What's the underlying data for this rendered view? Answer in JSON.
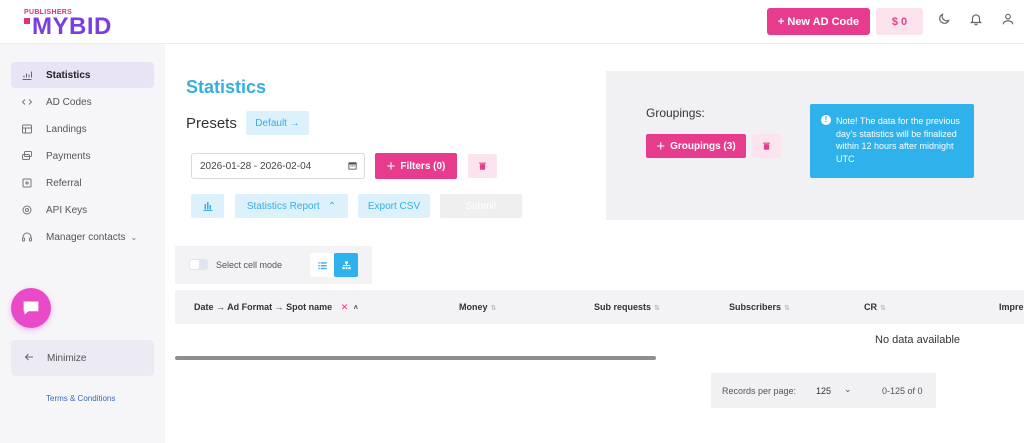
{
  "header": {
    "logo_small": "PUBLISHERS",
    "logo_big": "MYBID",
    "new_ad_label": "+ New AD Code",
    "balance_label": "$ 0"
  },
  "sidebar": {
    "items": [
      {
        "label": "Statistics",
        "icon": "chart-icon",
        "active": true
      },
      {
        "label": "AD Codes",
        "icon": "code-icon"
      },
      {
        "label": "Landings",
        "icon": "layout-icon"
      },
      {
        "label": "Payments",
        "icon": "payments-icon"
      },
      {
        "label": "Referral",
        "icon": "referral-icon"
      },
      {
        "label": "API Keys",
        "icon": "gear-icon"
      },
      {
        "label": "Manager contacts",
        "icon": "headset-icon"
      }
    ],
    "minimize_label": "Minimize",
    "terms_label": "Terms & Conditions"
  },
  "main": {
    "title": "Statistics",
    "presets_label": "Presets",
    "default_label": "Default →",
    "date_range": "2026-01-28 - 2026-02-04",
    "filters_label": "Filters (0)",
    "report_label": "Statistics Report",
    "export_label": "Export CSV",
    "submit_label": "Submit"
  },
  "groupings": {
    "label": "Groupings:",
    "button_label": "Groupings (3)",
    "note": "Note! The data for the previous day's statistics will be finalized within 12 hours after midnight UTC"
  },
  "table": {
    "cell_mode_label": "Select cell mode",
    "columns": [
      "Date → Ad Format → Spot name",
      "Money",
      "Sub requests",
      "Subscribers",
      "CR",
      "Impre"
    ],
    "empty_text": "No data available"
  },
  "pager": {
    "records_label": "Records per page:",
    "records_value": "125",
    "range": "0-125 of 0"
  },
  "colors": {
    "accent_pink": "#e73b8e",
    "accent_blue": "#35aee4",
    "logo_purple": "#7a3fe0"
  }
}
